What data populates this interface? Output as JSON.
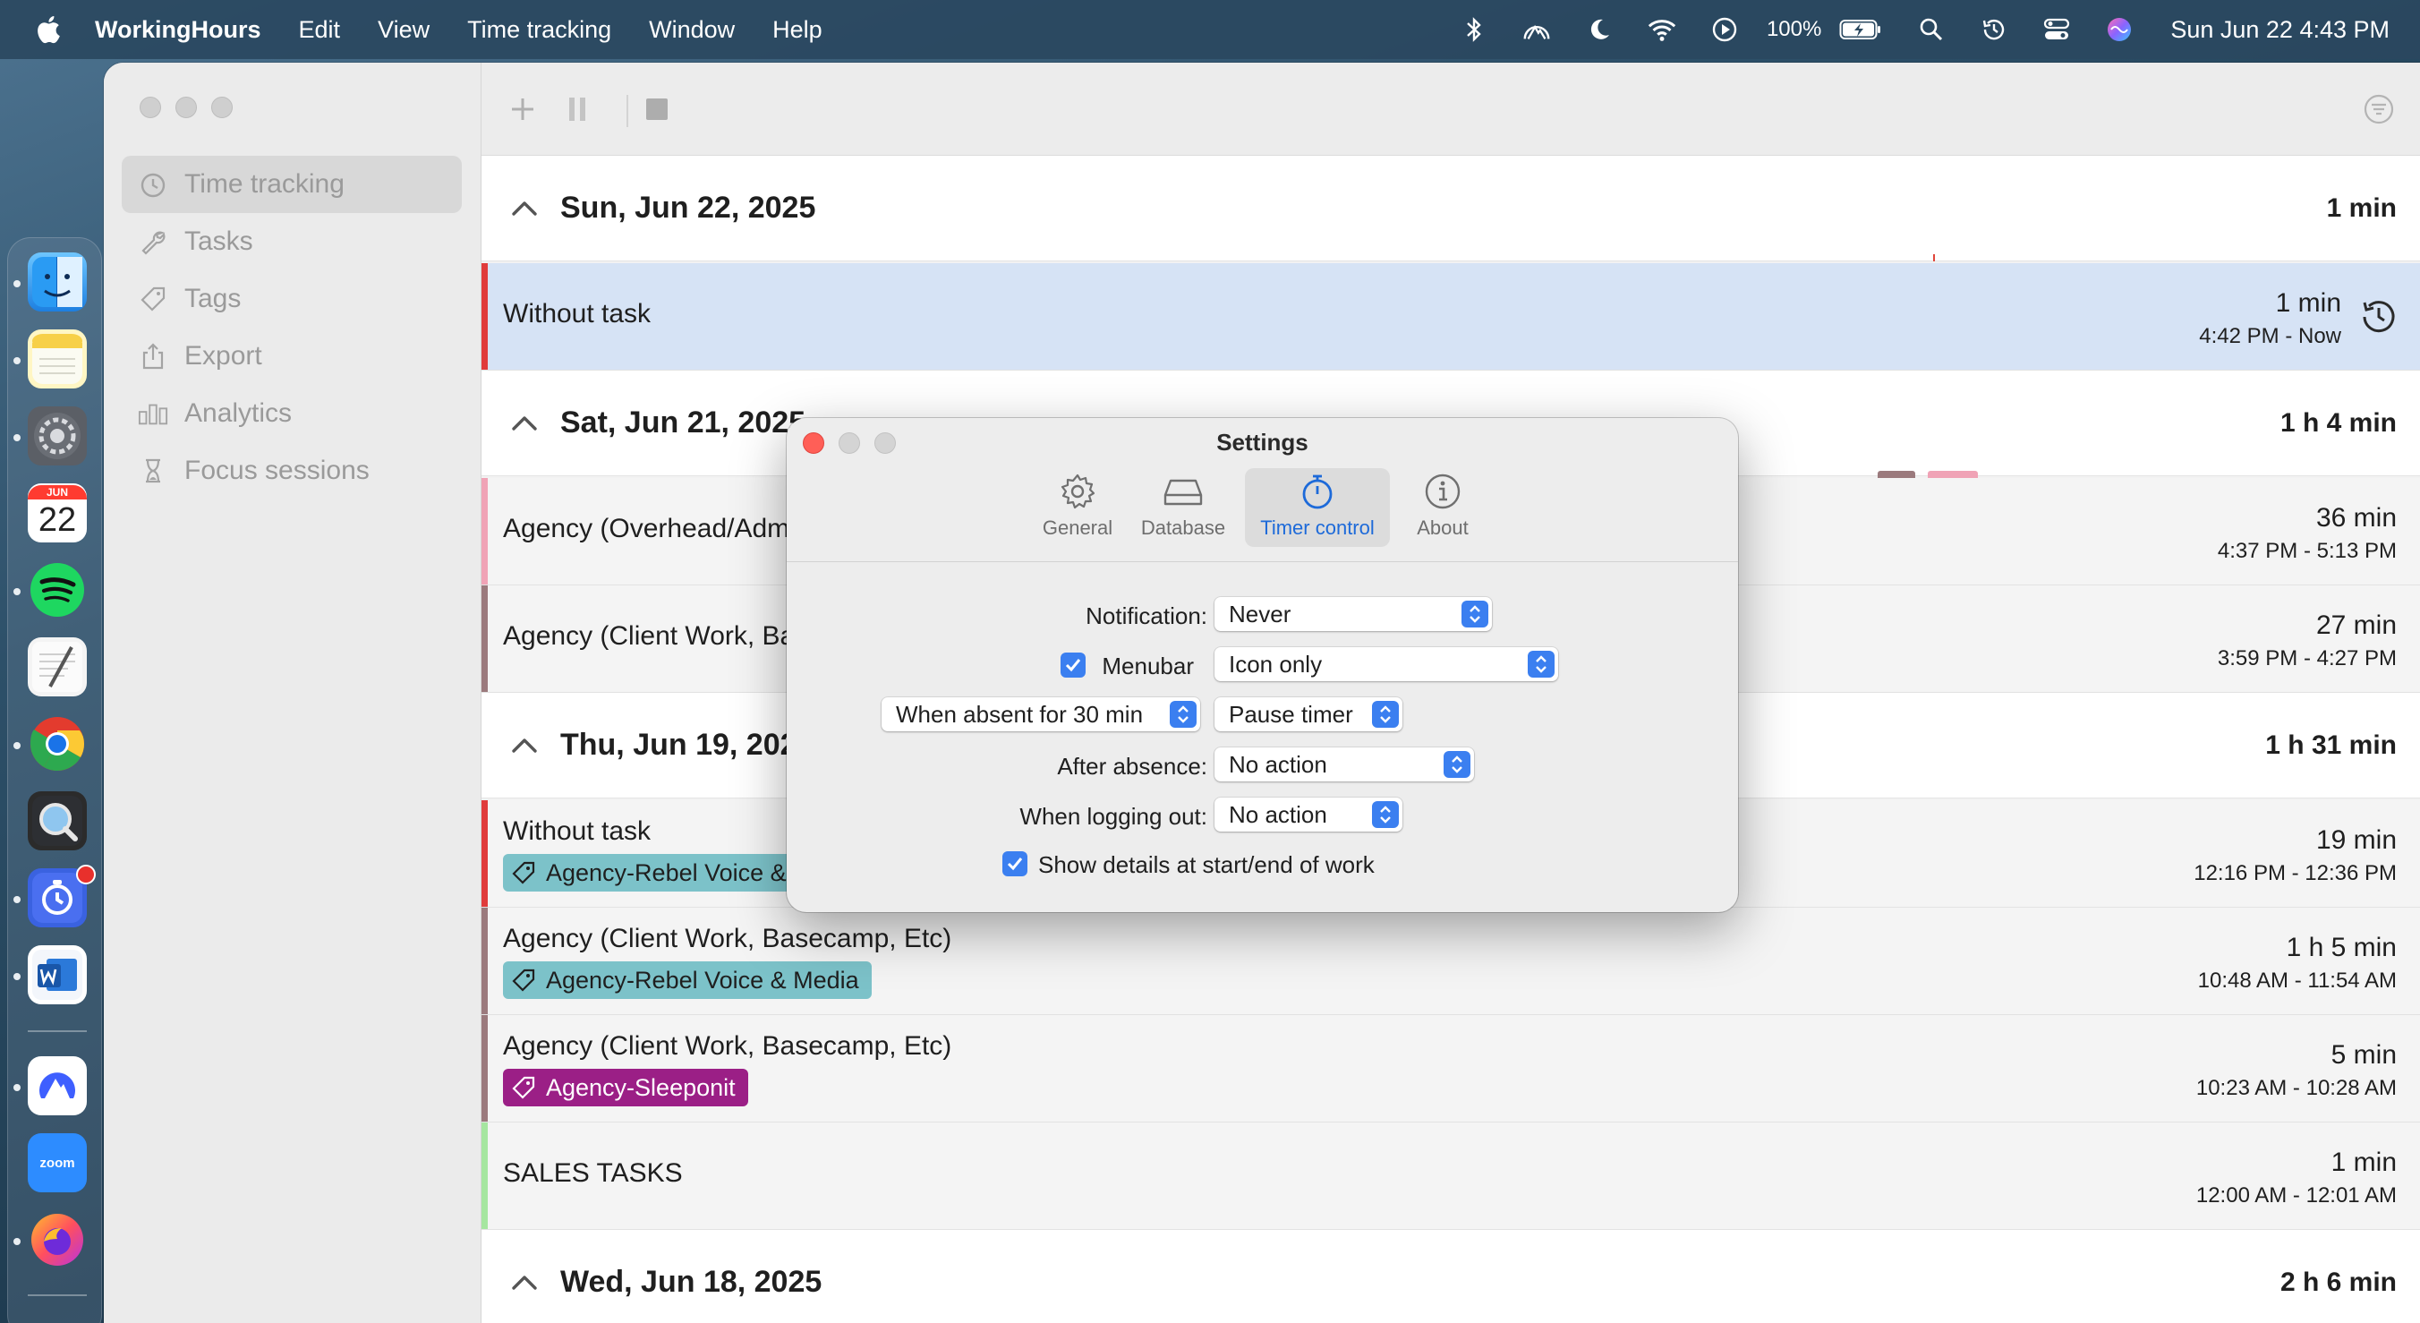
{
  "menubar": {
    "app_name": "WorkingHours",
    "menus": [
      "Edit",
      "View",
      "Time tracking",
      "Window",
      "Help"
    ],
    "battery": "100%",
    "datetime": "Sun Jun 22  4:43 PM"
  },
  "dock": {
    "calendar_month": "JUN",
    "calendar_day": "22",
    "zoom_label": "zoom"
  },
  "sidebar": {
    "items": [
      {
        "label": "Time tracking",
        "icon": "clock-icon"
      },
      {
        "label": "Tasks",
        "icon": "wrench-icon"
      },
      {
        "label": "Tags",
        "icon": "tag-icon"
      },
      {
        "label": "Export",
        "icon": "share-icon"
      },
      {
        "label": "Analytics",
        "icon": "bar-chart-icon"
      },
      {
        "label": "Focus sessions",
        "icon": "hourglass-icon"
      }
    ]
  },
  "days": [
    {
      "date": "Sun, Jun 22, 2025",
      "total": "1 min",
      "entries": [
        {
          "title": "Without task",
          "duration": "1 min",
          "range": "4:42 PM - Now",
          "color": "#e03b3b",
          "selected": true
        }
      ]
    },
    {
      "date": "Sat, Jun 21, 2025",
      "total": "1 h 4 min",
      "entries": [
        {
          "title": "Agency (Overhead/Admin)",
          "duration": "36 min",
          "range": "4:37 PM - 5:13 PM",
          "color": "#f0a3b6"
        },
        {
          "title": "Agency (Client Work, Basecamp, Etc)",
          "duration": "27 min",
          "range": "3:59 PM - 4:27 PM",
          "color": "#9b7a7d"
        }
      ]
    },
    {
      "date": "Thu, Jun 19, 2025",
      "total": "1 h 31 min",
      "entries": [
        {
          "title": "Without task",
          "tag": "Agency-Rebel Voice & Media",
          "duration": "19 min",
          "range": "12:16 PM - 12:36 PM",
          "color": "#e03b3b"
        },
        {
          "title": "Agency (Client Work, Basecamp, Etc)",
          "tag": "Agency-Rebel Voice & Media",
          "duration": "1 h 5 min",
          "range": "10:48 AM - 11:54 AM",
          "color": "#9b7a7d"
        },
        {
          "title": "Agency (Client Work, Basecamp, Etc)",
          "tag": "Agency-Sleeponit",
          "duration": "5 min",
          "range": "10:23 AM - 10:28 AM",
          "color": "#9b7a7d"
        },
        {
          "title": "SALES TASKS",
          "duration": "1 min",
          "range": "12:00 AM - 12:01 AM",
          "color": "#a6e6a0"
        }
      ]
    },
    {
      "date": "Wed, Jun 18, 2025",
      "total": "2 h 6 min"
    }
  ],
  "tag_colors": {
    "rebel": "#7cc2c9",
    "sleeponit": "#9b1f86"
  },
  "settings": {
    "title": "Settings",
    "tabs": [
      "General",
      "Database",
      "Timer control",
      "About"
    ],
    "active_tab": "Timer control",
    "notification_label": "Notification:",
    "notification_value": "Never",
    "menubar_label": "Menubar",
    "menubar_checked": true,
    "menubar_value": "Icon only",
    "absent_value": "When absent for 30 min",
    "absent_action": "Pause timer",
    "after_absence_label": "After absence:",
    "after_absence_value": "No action",
    "logout_label": "When logging out:",
    "logout_value": "No action",
    "details_label": "Show details at start/end of work",
    "details_checked": true
  }
}
